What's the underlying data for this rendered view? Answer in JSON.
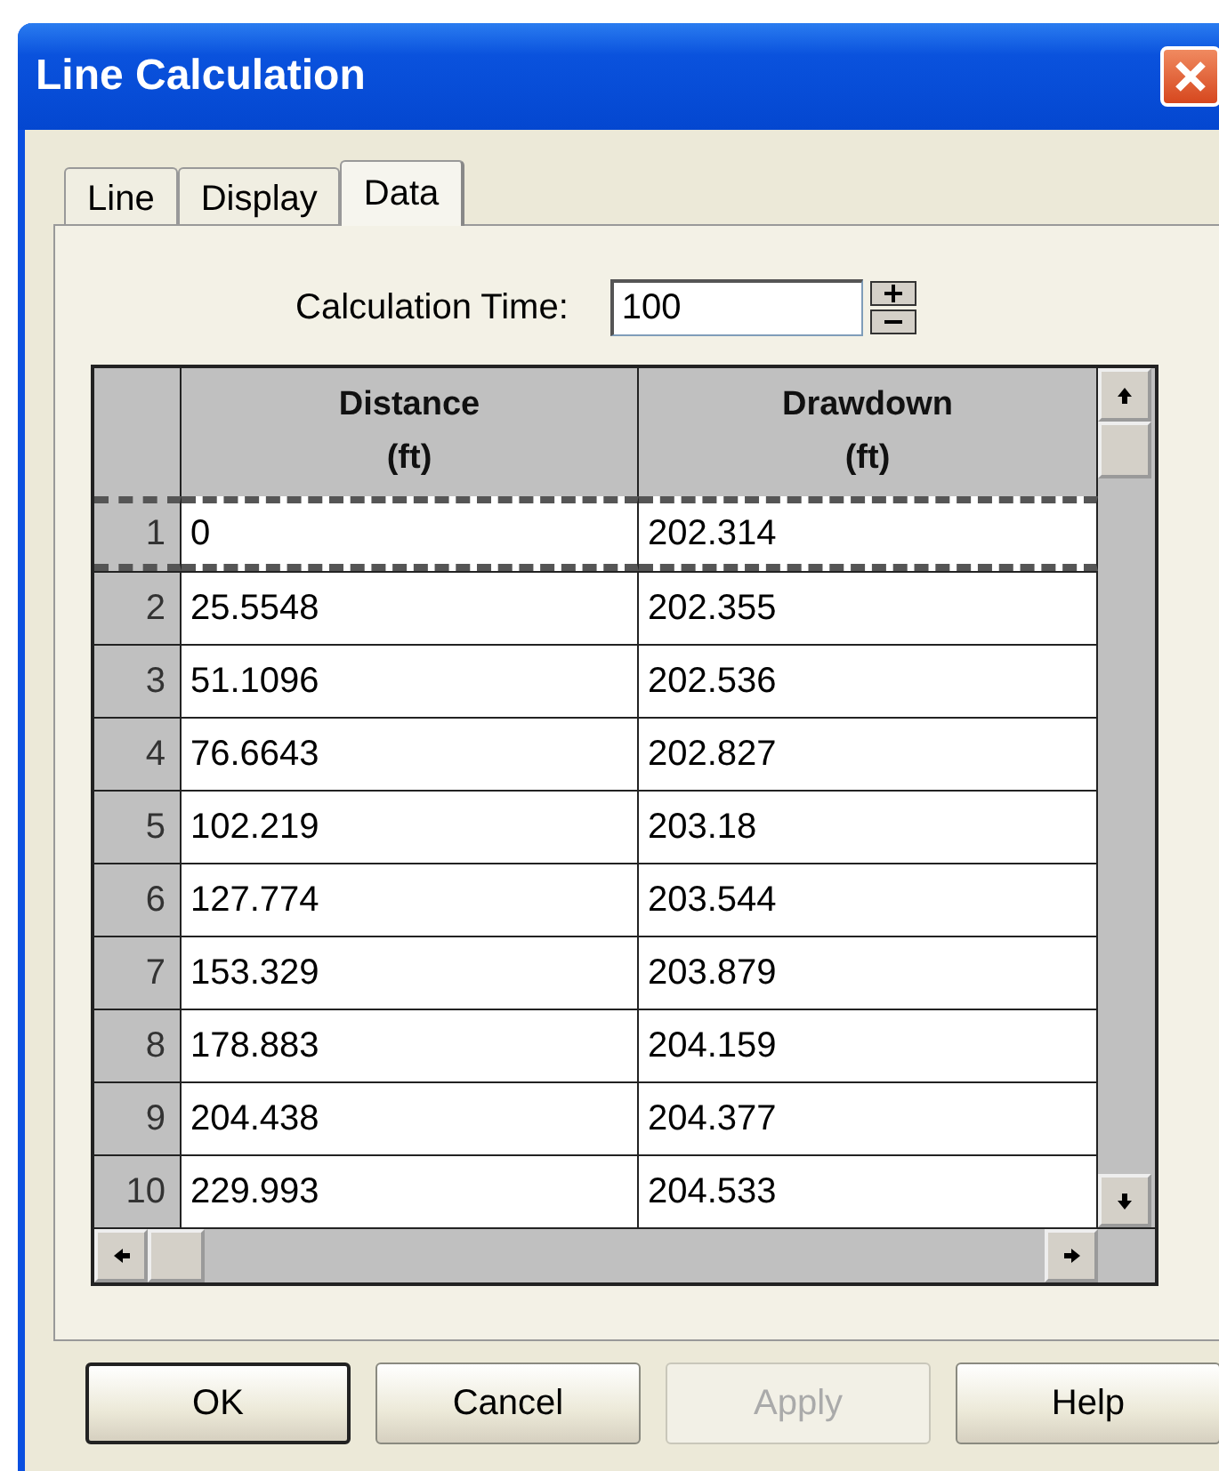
{
  "window": {
    "title": "Line Calculation"
  },
  "tabs": [
    {
      "label": "Line",
      "selected": false
    },
    {
      "label": "Display",
      "selected": false
    },
    {
      "label": "Data",
      "selected": true
    }
  ],
  "calculation_time": {
    "label": "Calculation Time:",
    "value": "100"
  },
  "table": {
    "columns": [
      {
        "title": "Distance",
        "unit": "(ft)"
      },
      {
        "title": "Drawdown",
        "unit": "(ft)"
      }
    ],
    "rows": [
      {
        "index": "1",
        "cells": [
          "0",
          "202.314"
        ],
        "frozen": true
      },
      {
        "index": "2",
        "cells": [
          "25.5548",
          "202.355"
        ],
        "frozen": false
      },
      {
        "index": "3",
        "cells": [
          "51.1096",
          "202.536"
        ],
        "frozen": false
      },
      {
        "index": "4",
        "cells": [
          "76.6643",
          "202.827"
        ],
        "frozen": false
      },
      {
        "index": "5",
        "cells": [
          "102.219",
          "203.18"
        ],
        "frozen": false
      },
      {
        "index": "6",
        "cells": [
          "127.774",
          "203.544"
        ],
        "frozen": false
      },
      {
        "index": "7",
        "cells": [
          "153.329",
          "203.879"
        ],
        "frozen": false
      },
      {
        "index": "8",
        "cells": [
          "178.883",
          "204.159"
        ],
        "frozen": false
      },
      {
        "index": "9",
        "cells": [
          "204.438",
          "204.377"
        ],
        "frozen": false
      },
      {
        "index": "10",
        "cells": [
          "229.993",
          "204.533"
        ],
        "frozen": false
      }
    ]
  },
  "buttons": [
    {
      "label": "OK",
      "disabled": false,
      "default": true
    },
    {
      "label": "Cancel",
      "disabled": false,
      "default": false
    },
    {
      "label": "Apply",
      "disabled": true,
      "default": false
    },
    {
      "label": "Help",
      "disabled": false,
      "default": false
    }
  ]
}
